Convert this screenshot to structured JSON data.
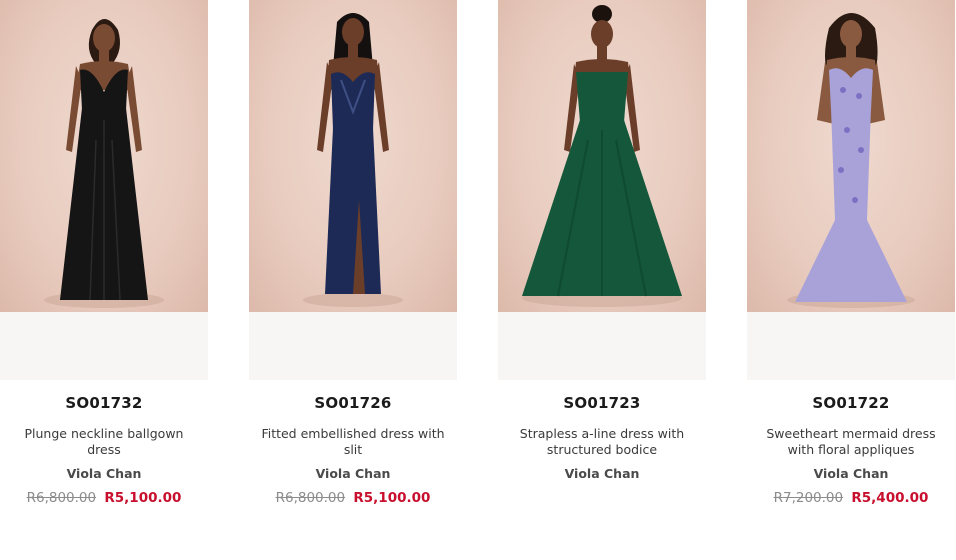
{
  "products": [
    {
      "code": "SO01732",
      "description": "Plunge neckline ballgown dress",
      "brand": "Viola Chan",
      "old_price": "R6,800.00",
      "price": "R5,100.00",
      "dress_color": "#151515"
    },
    {
      "code": "SO01726",
      "description": "Fitted embellished dress with slit",
      "brand": "Viola Chan",
      "old_price": "R6,800.00",
      "price": "R5,100.00",
      "dress_color": "#1d2a55"
    },
    {
      "code": "SO01723",
      "description": "Strapless a-line dress with structured bodice",
      "brand": "Viola Chan",
      "old_price": "",
      "price": "",
      "dress_color": "#14573b"
    },
    {
      "code": "SO01722",
      "description": "Sweetheart mermaid dress with floral appliques",
      "brand": "Viola Chan",
      "old_price": "R7,200.00",
      "price": "R5,400.00",
      "dress_color": "#a9a2d9"
    }
  ],
  "colors": {
    "sale_price": "#c8102e",
    "old_price": "#8c8c8c",
    "photo_background": "#e8cbbe",
    "skin": "#7a4b33"
  }
}
